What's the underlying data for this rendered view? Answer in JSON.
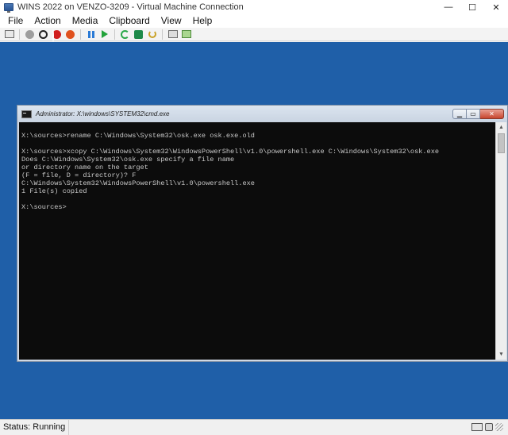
{
  "window": {
    "title": "WINS 2022 on VENZO-3209 - Virtual Machine Connection",
    "controls": {
      "minimize": "—",
      "maximize": "☐",
      "close": "✕"
    }
  },
  "menu": {
    "items": [
      "File",
      "Action",
      "Media",
      "Clipboard",
      "View",
      "Help"
    ]
  },
  "toolbar": {
    "icons": [
      "ctrl-alt-del-icon",
      "start-icon",
      "turn-off-icon",
      "shut-down-icon",
      "power-icon",
      "pause-icon",
      "resume-icon",
      "reset-icon",
      "checkpoint-icon",
      "revert-icon",
      "enhanced-session-icon",
      "share-icon"
    ]
  },
  "cmd": {
    "title": "Administrator: X:\\windows\\SYSTEM32\\cmd.exe",
    "controls": {
      "minimize": "▁",
      "maximize": "▭",
      "close": "✕"
    },
    "lines": [
      "",
      "X:\\sources>rename C:\\Windows\\System32\\osk.exe osk.exe.old",
      "",
      "X:\\sources>xcopy C:\\Windows\\System32\\WindowsPowerShell\\v1.0\\powershell.exe C:\\Windows\\System32\\osk.exe",
      "Does C:\\Windows\\System32\\osk.exe specify a file name",
      "or directory name on the target",
      "(F = file, D = directory)? F",
      "C:\\Windows\\System32\\WindowsPowerShell\\v1.0\\powershell.exe",
      "1 File(s) copied",
      "",
      "X:\\sources>"
    ],
    "scroll": {
      "up": "▲",
      "down": "▼"
    }
  },
  "colors": {
    "vm_background": "#1f5fa8",
    "console_background": "#0c0c0c",
    "console_text": "#c8c8c8"
  },
  "status": {
    "text": "Status: Running"
  }
}
